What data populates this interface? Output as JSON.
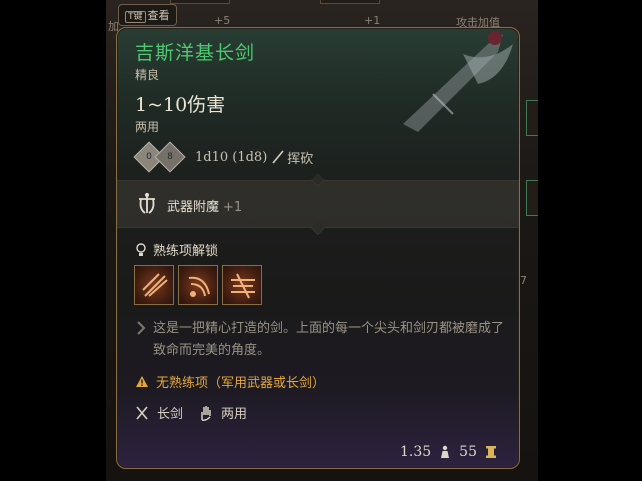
{
  "background": {
    "keytag_key": "T键",
    "keytag_label": "查看",
    "left_label": "加",
    "slot_plus_left": "+5",
    "slot_plus_right": "+1",
    "top_right_label": "攻击加值",
    "right_number": "7"
  },
  "tooltip": {
    "title": "吉斯洋基长剑",
    "rarity": "精良",
    "damage": "1~10伤害",
    "handedness": "两用",
    "dice": {
      "die1": "0",
      "die2": "8"
    },
    "dice_text": "1d10 (1d8)",
    "damage_type": "挥砍",
    "enchant_label": "武器附魔",
    "enchant_value": "+1",
    "proficiency_header": "熟练项解锁",
    "proficiency_icons": [
      "slash-attack-icon",
      "lacerate-icon",
      "pommel-strike-icon"
    ],
    "description": "这是一把精心打造的剑。上面的每一个尖头和剑刃都被磨成了致命而完美的角度。",
    "warning": "无熟练项（军用武器或长剑）",
    "tag_weapon": "长剑",
    "tag_hands": "两用",
    "weight": "1.35",
    "gold": "55"
  },
  "colors": {
    "title": "#4ec96f",
    "warning": "#e4a83a",
    "border": "#8a6d45"
  }
}
